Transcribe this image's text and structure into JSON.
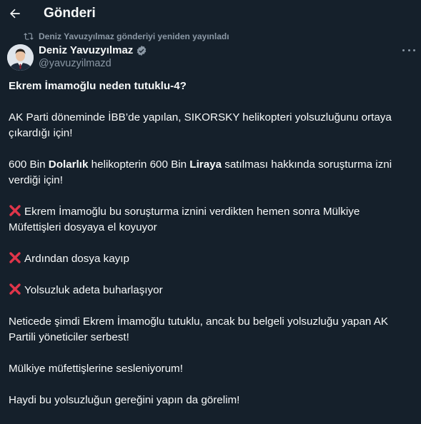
{
  "header": {
    "title": "Gönderi",
    "back_icon": "arrow-left-icon"
  },
  "repost": {
    "text": "Deniz Yavuzyılmaz gönderiyi yeniden yayınladı",
    "icon": "repost-icon"
  },
  "author": {
    "name": "Deniz Yavuzyılmaz",
    "handle": "@yavuzyilmazd",
    "verified_color": "#8b98a5"
  },
  "post": {
    "heading": "Ekrem İmamoğlu neden tutuklu-4?",
    "p1": "AK Parti döneminde İBB’de yapılan, SIKORSKY helikopteri yolsuzluğunu ortaya çıkardığı için!",
    "p2": {
      "t1": "600 Bin ",
      "b1": "Dolarlık",
      "t2": " helikopterin 600 Bin ",
      "b2": "Liraya",
      "t3": " satılması hakkında soruşturma izni verdiği için!"
    },
    "x1": "Ekrem İmamoğlu bu soruşturma iznini verdikten hemen sonra Mülkiye Müfettişleri dosyaya el koyuyor",
    "x2": "Ardından dosya kayıp",
    "x3": "Yolsuzluk adeta buharlaşıyor",
    "p3": "Neticede şimdi Ekrem İmamoğlu tutuklu, ancak bu belgeli yolsuzluğu yapan AK Partili yöneticiler serbest!",
    "p4": "Mülkiye müfettişlerine sesleniyorum!",
    "p5": "Haydi bu yolsuzluğun gereğini yapın da görelim!",
    "xmark_icon": "cross-mark-icon",
    "xmark_color": "#e0354a"
  },
  "colors": {
    "background": "#15202b",
    "text": "#f7f9f9",
    "muted": "#8b98a5"
  }
}
